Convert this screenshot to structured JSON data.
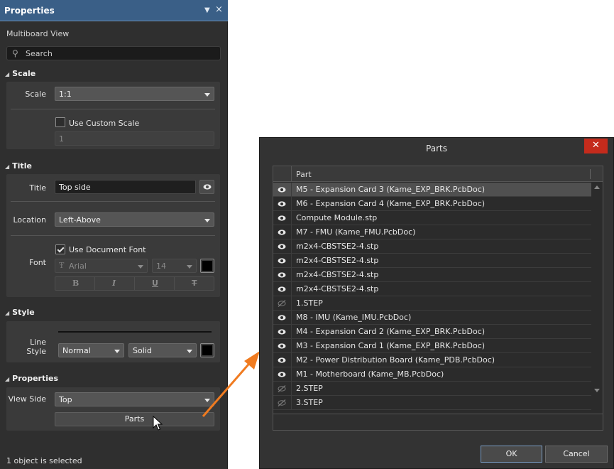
{
  "panel": {
    "title": "Properties",
    "subtitle": "Multiboard View",
    "search_placeholder": "Search",
    "status_text": "1 object is selected"
  },
  "scale_section": {
    "header": "Scale",
    "scale_label": "Scale",
    "scale_value": "1:1",
    "use_custom_scale_label": "Use Custom Scale",
    "use_custom_scale_checked": false,
    "custom_scale_value": "1"
  },
  "title_section": {
    "header": "Title",
    "title_label": "Title",
    "title_value": "Top side",
    "location_label": "Location",
    "location_value": "Left-Above",
    "font_label": "Font",
    "use_document_font_label": "Use Document Font",
    "use_document_font_checked": true,
    "font_family": "Arial",
    "font_size": "14",
    "font_color": "#000000",
    "style_buttons": [
      "B",
      "I",
      "U",
      "T"
    ]
  },
  "style_section": {
    "header": "Style",
    "line_style_label": "Line Style",
    "line_weight": "Normal",
    "line_type": "Solid",
    "line_color": "#000000"
  },
  "properties_section": {
    "header": "Properties",
    "view_side_label": "View Side",
    "view_side_value": "Top",
    "parts_button": "Parts"
  },
  "dialog": {
    "title": "Parts",
    "column_header": "Part",
    "ok_button": "OK",
    "cancel_button": "Cancel",
    "rows": [
      {
        "name": "M5 - Expansion Card 3 (Kame_EXP_BRK.PcbDoc)",
        "visible": true,
        "selected": true
      },
      {
        "name": "M6 - Expansion Card 4 (Kame_EXP_BRK.PcbDoc)",
        "visible": true,
        "selected": false
      },
      {
        "name": "Compute Module.stp",
        "visible": true,
        "selected": false
      },
      {
        "name": "M7 - FMU (Kame_FMU.PcbDoc)",
        "visible": true,
        "selected": false
      },
      {
        "name": "m2x4-CBSTSE2-4.stp",
        "visible": true,
        "selected": false
      },
      {
        "name": "m2x4-CBSTSE2-4.stp",
        "visible": true,
        "selected": false
      },
      {
        "name": "m2x4-CBSTSE2-4.stp",
        "visible": true,
        "selected": false
      },
      {
        "name": "m2x4-CBSTSE2-4.stp",
        "visible": true,
        "selected": false
      },
      {
        "name": "1.STEP",
        "visible": false,
        "selected": false
      },
      {
        "name": "M8 - IMU (Kame_IMU.PcbDoc)",
        "visible": true,
        "selected": false
      },
      {
        "name": "M4 - Expansion Card 2 (Kame_EXP_BRK.PcbDoc)",
        "visible": true,
        "selected": false
      },
      {
        "name": "M3 - Expansion Card 1 (Kame_EXP_BRK.PcbDoc)",
        "visible": true,
        "selected": false
      },
      {
        "name": "M2 - Power Distribution Board (Kame_PDB.PcbDoc)",
        "visible": true,
        "selected": false
      },
      {
        "name": "M1 - Motherboard (Kame_MB.PcbDoc)",
        "visible": true,
        "selected": false
      },
      {
        "name": "2.STEP",
        "visible": false,
        "selected": false
      },
      {
        "name": "3.STEP",
        "visible": false,
        "selected": false
      }
    ]
  },
  "colors": {
    "panel_header": "#3a5f87",
    "annotation_arrow": "#f07b20",
    "close_button": "#c42b1c"
  }
}
